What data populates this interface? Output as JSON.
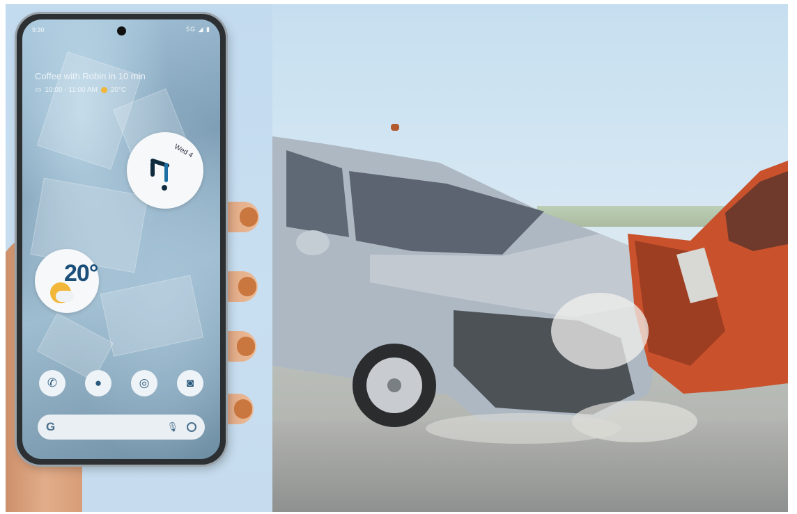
{
  "phone": {
    "status_time": "9:30",
    "status_icons": "5G ◢ ▮",
    "glance": {
      "title": "Coffee with Robin in 10 min",
      "time_range": "10:00 - 11:00 AM",
      "weather_small": "20°C"
    },
    "clock": {
      "date": "Wed 4"
    },
    "weather": {
      "temperature": "20°"
    },
    "dock": [
      {
        "name": "phone-icon",
        "glyph": "✆"
      },
      {
        "name": "messages-icon",
        "glyph": "●"
      },
      {
        "name": "chrome-icon",
        "glyph": "◎"
      },
      {
        "name": "camera-icon",
        "glyph": "◙"
      }
    ],
    "search": {
      "logo": "G",
      "mic_glyph": "🎙"
    }
  },
  "colors": {
    "background": "#c9def0",
    "accent": "#1b4f7a",
    "car_silver": "#a8b2bd",
    "car_red": "#c9522c"
  }
}
